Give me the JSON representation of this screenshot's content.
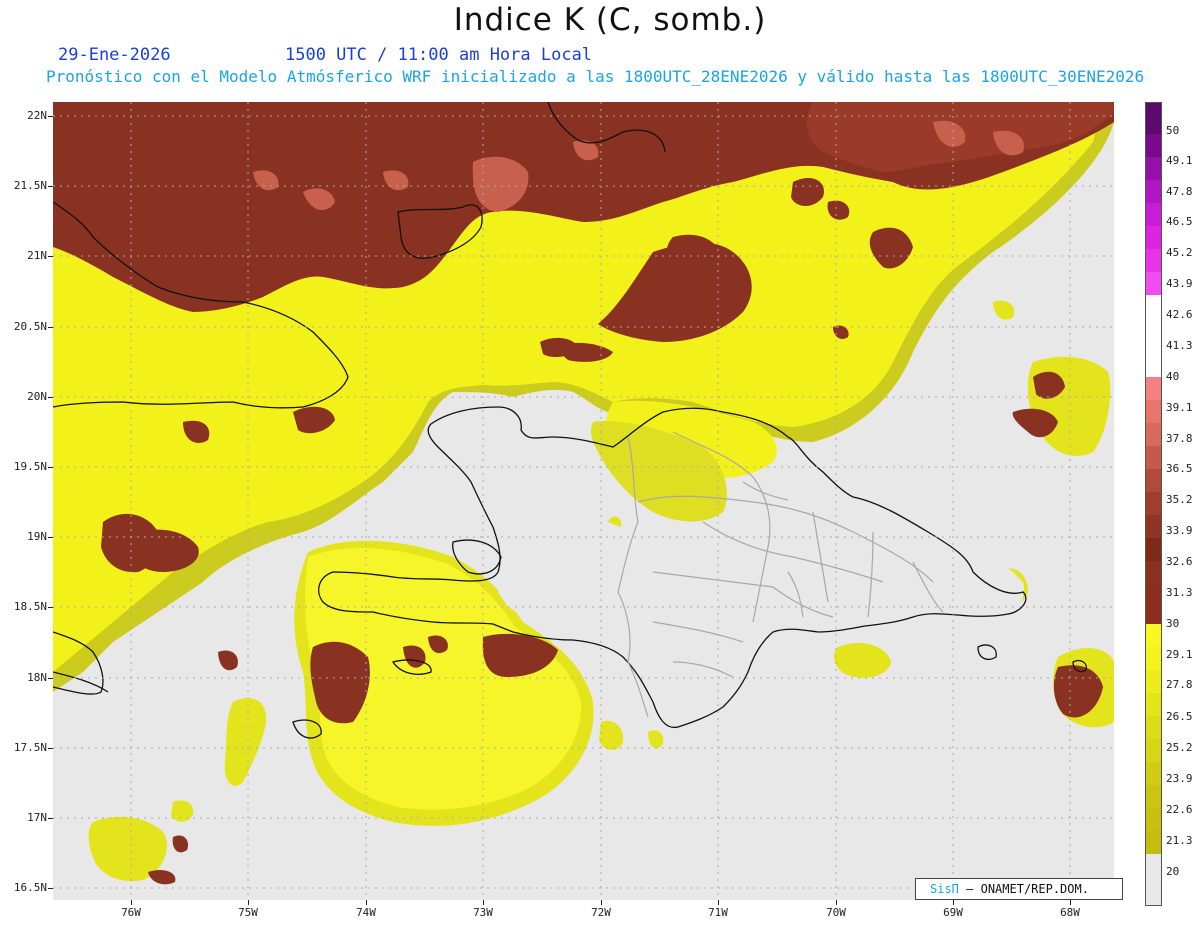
{
  "header": {
    "title": "Indice K (C, somb.)",
    "date": "29-Ene-2026",
    "time": "1500 UTC / 11:00 am Hora Local",
    "forecast_note": "Pronóstico con el Modelo Atmósferico WRF inicializado a las 1800UTC_28ENE2026 y válido hasta las  1800UTC_30ENE2026"
  },
  "axes": {
    "lat_labels": [
      "22N",
      "21.5N",
      "21N",
      "20.5N",
      "20N",
      "19.5N",
      "19N",
      "18.5N",
      "18N",
      "17.5N",
      "17N",
      "16.5N"
    ],
    "lon_labels": [
      "76W",
      "75W",
      "74W",
      "73W",
      "72W",
      "71W",
      "70W",
      "69W",
      "68W"
    ]
  },
  "colorbar": {
    "labels": [
      "50",
      "49.1",
      "47.8",
      "46.5",
      "45.2",
      "43.9",
      "42.6",
      "41.3",
      "40",
      "39.1",
      "37.8",
      "36.5",
      "35.2",
      "33.9",
      "32.6",
      "31.3",
      "30",
      "29.1",
      "27.8",
      "26.5",
      "25.2",
      "23.9",
      "22.6",
      "21.3",
      "20"
    ],
    "colors": {
      "purple_top": "#5c0a6e",
      "magenta": "#e020e0",
      "pink": "#f08080",
      "brown": "#8b2e1e",
      "yellow": "#f5f510",
      "olive_bottom": "#c8c010",
      "none": "#e8e8e8"
    }
  },
  "credit": {
    "brand": "SisΠ",
    "org": "– ONAMET/REP.DOM."
  },
  "map_colors": {
    "background": "#e8e8e8",
    "yellow_light": "#f2f21a",
    "yellow_mid": "#e0e020",
    "olive": "#cccc1e",
    "brown": "#8a3222",
    "salmon": "#d9706a",
    "coast": "#111111",
    "borders": "#a8a8a8"
  }
}
